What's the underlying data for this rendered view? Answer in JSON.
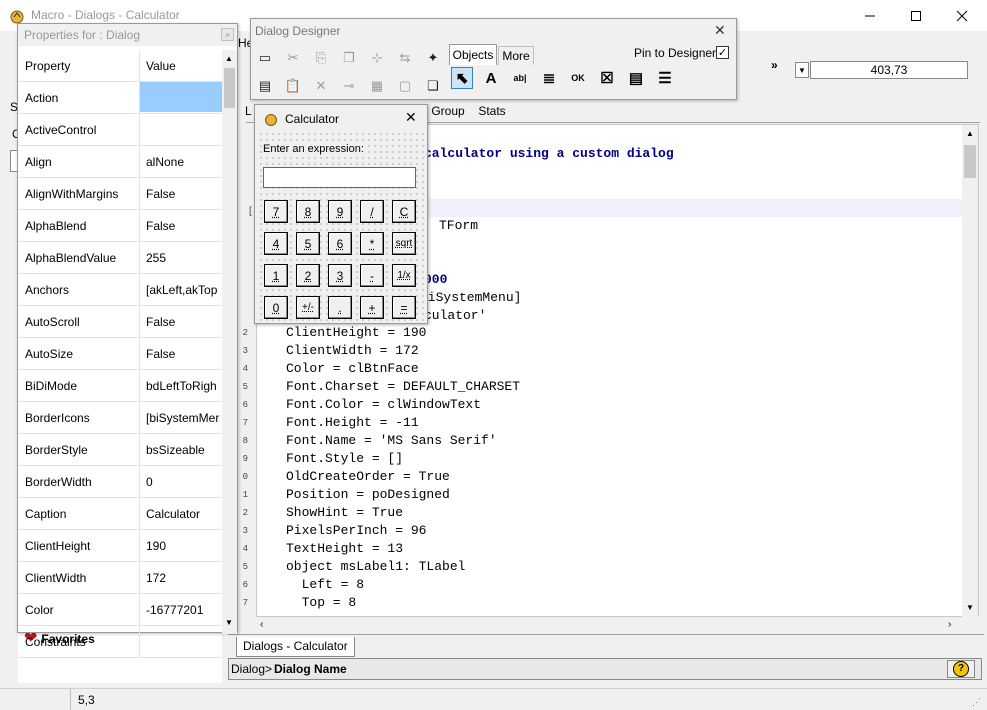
{
  "window": {
    "title": "Macro - Dialogs - Calculator",
    "min_icon": "minimize-icon",
    "max_icon": "maximize-icon",
    "close_icon": "close-icon"
  },
  "menu_fragment": "He",
  "left_tabs": {
    "top_label": "L",
    "s_label": "S",
    "c_label": "C"
  },
  "editor_tabs": {
    "group": "Group",
    "stats": "Stats"
  },
  "toolbar_value": "403,73",
  "properties": {
    "title": "Properties for : Dialog",
    "col_property": "Property",
    "col_value": "Value",
    "rows": [
      {
        "name": "Action",
        "value": ""
      },
      {
        "name": "ActiveControl",
        "value": ""
      },
      {
        "name": "Align",
        "value": "alNone"
      },
      {
        "name": "AlignWithMargins",
        "value": "False"
      },
      {
        "name": "AlphaBlend",
        "value": "False"
      },
      {
        "name": "AlphaBlendValue",
        "value": "255"
      },
      {
        "name": "Anchors",
        "value": "[akLeft,akTop"
      },
      {
        "name": "AutoScroll",
        "value": "False"
      },
      {
        "name": "AutoSize",
        "value": "False"
      },
      {
        "name": "BiDiMode",
        "value": "bdLeftToRigh"
      },
      {
        "name": "BorderIcons",
        "value": "[biSystemMer"
      },
      {
        "name": "BorderStyle",
        "value": "bsSizeable"
      },
      {
        "name": "BorderWidth",
        "value": "0"
      },
      {
        "name": "Caption",
        "value": "Calculator"
      },
      {
        "name": "ClientHeight",
        "value": "190"
      },
      {
        "name": "ClientWidth",
        "value": "172"
      },
      {
        "name": "Color",
        "value": "-16777201"
      },
      {
        "name": "Constraints",
        "value": ""
      }
    ]
  },
  "favorites": "Favorites",
  "designer": {
    "title": "Dialog Designer",
    "tab_objects": "Objects",
    "tab_more": "More",
    "pin_label": "Pin to Designer",
    "pin_checked": true
  },
  "calculator": {
    "title": "Calculator",
    "prompt": "Enter an expression:",
    "input_value": "",
    "keys": [
      [
        "7",
        "8",
        "9",
        "/",
        "C"
      ],
      [
        "4",
        "5",
        "6",
        "*",
        "sqrt"
      ],
      [
        "1",
        "2",
        "3",
        "-",
        "1/x"
      ],
      [
        "0",
        "+/-",
        ".",
        "+",
        "="
      ]
    ]
  },
  "code": {
    "lines": [
      {
        "n": "",
        "t": "calculator using a custom dialog"
      },
      {
        "n": "",
        "t": "TForm"
      },
      {
        "n": "",
        "t": "000"
      },
      {
        "n": "",
        "t": "biSystemMenu]"
      },
      {
        "n": "",
        "t": "culator'"
      },
      {
        "n": "2",
        "t": "ClientHeight = 190"
      },
      {
        "n": "3",
        "t": "ClientWidth = 172"
      },
      {
        "n": "4",
        "t": "Color = clBtnFace"
      },
      {
        "n": "5",
        "t": "Font.Charset = DEFAULT_CHARSET"
      },
      {
        "n": "6",
        "t": "Font.Color = clWindowText"
      },
      {
        "n": "7",
        "t": "Font.Height = -11"
      },
      {
        "n": "8",
        "t": "Font.Name = 'MS Sans Serif'"
      },
      {
        "n": "9",
        "t": "Font.Style = []"
      },
      {
        "n": "0",
        "t": "OldCreateOrder = True"
      },
      {
        "n": "1",
        "t": "Position = poDesigned"
      },
      {
        "n": "2",
        "t": "ShowHint = True"
      },
      {
        "n": "3",
        "t": "PixelsPerInch = 96"
      },
      {
        "n": "4",
        "t": "TextHeight = 13"
      },
      {
        "n": "5",
        "t": "object msLabel1: TLabel"
      },
      {
        "n": "6",
        "t": "  Left = 8"
      },
      {
        "n": "7",
        "t": "  Top = 8"
      }
    ]
  },
  "doc_tab": "Dialogs - Calculator",
  "breadcrumb": {
    "prefix": "Dialog>",
    "name": "Dialog Name"
  },
  "status": {
    "position": "5,3"
  },
  "colors": {
    "selection": "#99ccff",
    "highlight_line": "#f4eefc",
    "code_keyword": "#000080"
  }
}
